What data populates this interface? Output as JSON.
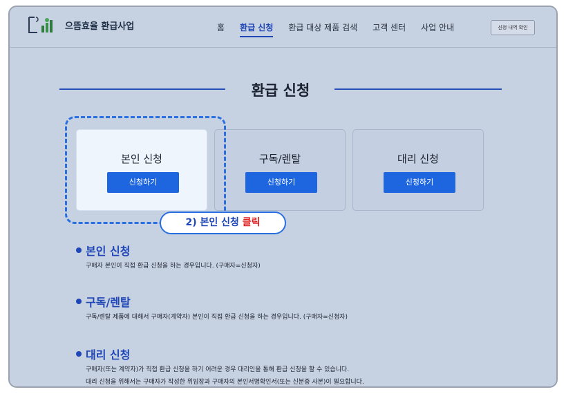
{
  "header": {
    "logo_text": "으뜸효율 환급사업",
    "nav": [
      "홈",
      "환급 신청",
      "환급 대상 제품 검색",
      "고객 센터",
      "사업 안내"
    ],
    "active_nav": "환급 신청",
    "status_button": "신청 내역 확인"
  },
  "page": {
    "title": "환급 신청"
  },
  "cards": [
    {
      "title": "본인 신청",
      "button": "신청하기",
      "highlighted": true
    },
    {
      "title": "구독/렌탈",
      "button": "신청하기",
      "highlighted": false
    },
    {
      "title": "대리 신청",
      "button": "신청하기",
      "highlighted": false
    }
  ],
  "callout": {
    "prefix": "2) 본인 신청 ",
    "action": "클릭"
  },
  "sections": [
    {
      "title": "본인 신청",
      "lines": [
        "구매자 본인이 직접 환급 신청을 하는 경우입니다. (구매자=신청자)"
      ]
    },
    {
      "title": "구독/렌탈",
      "lines": [
        "구독/렌탈 제품에 대해서 구매자(계약자) 본인이 직접 환급 신청을 하는 경우입니다. (구매자=신청자)"
      ]
    },
    {
      "title": "대리 신청",
      "lines": [
        "구매자(또는 계약자)가 직접 환급 신청을 하기 어려운 경우 대리인을 통해 환급 신청을 할 수 있습니다.",
        "대리 신청을 위해서는 구매자가 작성한 위임장과 구매자의 본인서명확인서(또는 신분증 사본)이 필요합니다."
      ]
    }
  ],
  "colors": {
    "accent": "#1f46b6",
    "button": "#1d66e0",
    "highlight_dash": "#2a6fe0",
    "callout_red": "#e02020",
    "background": "#c6d1e2"
  }
}
